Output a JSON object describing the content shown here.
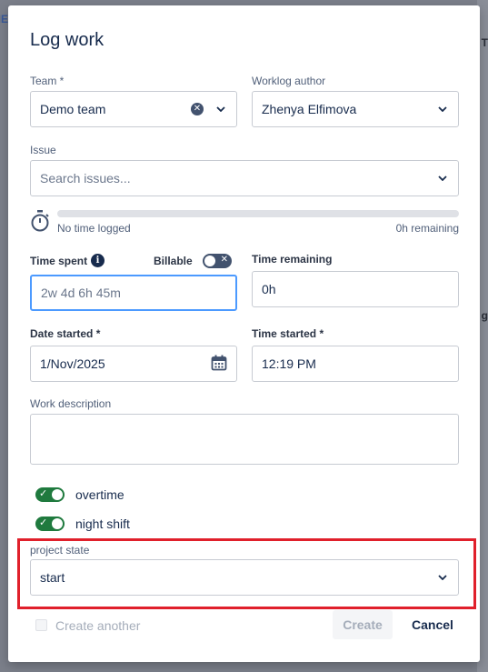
{
  "dialog": {
    "title": "Log work"
  },
  "team": {
    "label": "Team *",
    "value": "Demo team"
  },
  "author": {
    "label": "Worklog author",
    "value": "Zhenya Elfimova"
  },
  "issue": {
    "label": "Issue",
    "placeholder": "Search issues..."
  },
  "time_tracking": {
    "logged_text": "No time logged",
    "remaining_text": "0h remaining",
    "progress_percent": 0
  },
  "time_spent": {
    "label": "Time spent",
    "placeholder": "2w 4d 6h 45m"
  },
  "billable": {
    "label": "Billable",
    "on": false
  },
  "time_remaining": {
    "label": "Time remaining",
    "value": "0h"
  },
  "date_started": {
    "label": "Date started *",
    "value": "1/Nov/2025"
  },
  "time_started": {
    "label": "Time started *",
    "value": "12:19 PM"
  },
  "work_description": {
    "label": "Work description",
    "value": ""
  },
  "toggles": [
    {
      "label": "overtime",
      "on": true
    },
    {
      "label": "night shift",
      "on": true
    }
  ],
  "project_state": {
    "label": "project state",
    "value": "start"
  },
  "footer": {
    "create_another_label": "Create another",
    "create_label": "Create",
    "cancel_label": "Cancel"
  },
  "backdrop": {
    "fragment_top": "IE",
    "fragment_t": "T",
    "fragment_g": "g"
  },
  "colors": {
    "accent": "#4c9aff",
    "toggle_on": "#1f7a3e",
    "highlight": "#e0202b"
  }
}
